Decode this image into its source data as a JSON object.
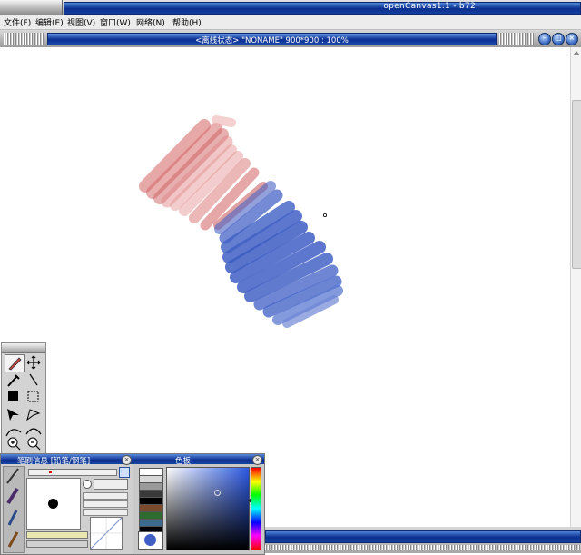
{
  "app": {
    "title": "openCanvas1.1 - b72"
  },
  "menu": [
    {
      "label": "文件(F)"
    },
    {
      "label": "编辑(E)"
    },
    {
      "label": "视图(V)"
    },
    {
      "label": "窗口(W)"
    },
    {
      "label": "网络(N)"
    },
    {
      "label": "帮助(H)"
    }
  ],
  "document": {
    "title": "<离线状态> \"NONAME\" 900*900 : 100%",
    "buttons": {
      "minimize": "–",
      "maximize": "□",
      "close": "×"
    }
  },
  "brush_panel": {
    "title": "笔刷信息 [铅笔/钢笔]",
    "close": "×"
  },
  "palette_panel": {
    "title": "色板",
    "close": "×"
  },
  "colors": {
    "red_stroke": "#d05a5a",
    "blue_stroke": "#3f5fc4",
    "current_color": "#3f5fc4",
    "swatches": [
      "#ffffff",
      "#d8d8d8",
      "#9a9a9a",
      "#3a3a3a",
      "#000000",
      "#7a4a2a",
      "#2e6b2e",
      "#3b6b8e",
      "#000000"
    ]
  },
  "tool_icons": [
    "pencil-icon",
    "move-icon",
    "eyedropper-icon",
    "line-icon",
    "fill-color-icon",
    "select-rect-icon",
    "shape-fill-icon",
    "lasso-icon",
    "curve-icon",
    "curve-smooth-icon",
    "zoom-in-icon",
    "zoom-out-icon"
  ]
}
